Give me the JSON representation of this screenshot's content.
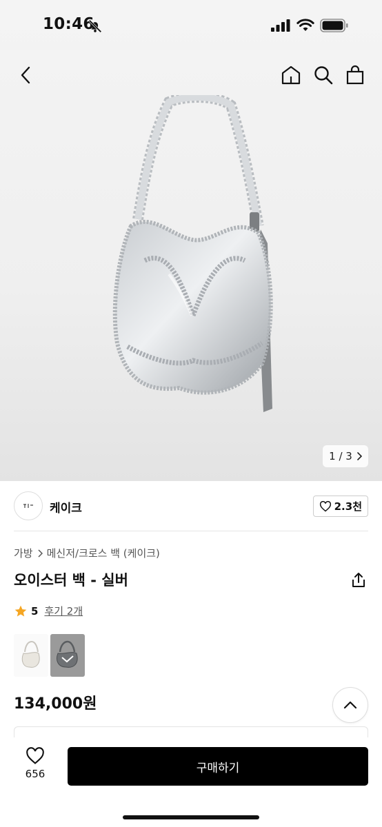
{
  "status_bar": {
    "time": "10:46"
  },
  "header": {
    "back_icon": "chevron-left-icon",
    "home_icon": "home-icon",
    "search_icon": "search-icon",
    "bag_icon": "shopping-bag-icon"
  },
  "gallery": {
    "counter": "1 / 3",
    "current": 1,
    "total": 3
  },
  "brand": {
    "name": "케이크",
    "likes": "2.3천"
  },
  "breadcrumb": {
    "category": "가방",
    "subcategory": "메신저/크로스 백 (케이크)"
  },
  "product": {
    "title": "오이스터 백 - 실버",
    "rating": "5",
    "review_text": "후기 2개",
    "price": "134,000원",
    "swatches": [
      "white",
      "silver"
    ]
  },
  "bottom_bar": {
    "wish_count": "656",
    "buy_label": "구매하기"
  },
  "colors": {
    "accent": "#000000",
    "star": "#f5a623"
  }
}
